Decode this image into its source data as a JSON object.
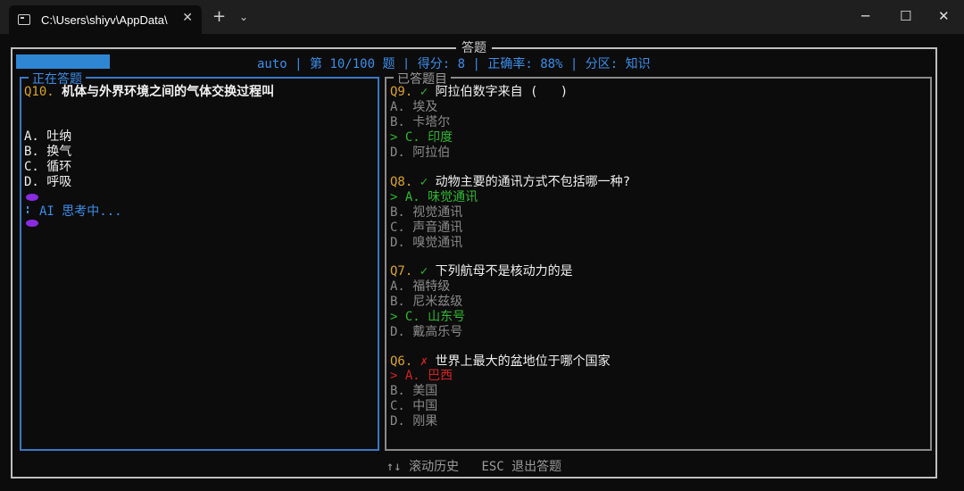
{
  "window": {
    "tab_title": "C:\\Users\\shiyv\\AppData\\",
    "tab_close": "✕",
    "new_tab": "+",
    "dropdown": "⌄",
    "minimize": "─",
    "maximize": "☐",
    "close": "✕"
  },
  "app": {
    "title": "答题",
    "status": {
      "mode": "auto",
      "question": "第 10/100 题",
      "score": "得分: 8",
      "accuracy": "正确率: 88%",
      "category": "分区: 知识"
    }
  },
  "current": {
    "panel_title": "正在答题",
    "q_number": "Q10.",
    "q_text": "机体与外界环境之间的气体交换过程叫",
    "options": [
      "A. 吐纳",
      "B. 换气",
      "C. 循环",
      "D. 呼吸"
    ],
    "thinking": "AI 思考中..."
  },
  "history": {
    "panel_title": "已答题目",
    "items": [
      {
        "number": "Q9.",
        "mark": "✓",
        "text": "阿拉伯数字来自 (   )",
        "options": [
          "A. 埃及",
          "B. 卡塔尔",
          "> C. 印度",
          "D. 阿拉伯"
        ]
      },
      {
        "number": "Q8.",
        "mark": "✓",
        "text": "动物主要的通讯方式不包括哪一种?",
        "options": [
          "> A. 味觉通讯",
          "B. 视觉通讯",
          "C. 声音通讯",
          "D. 嗅觉通讯"
        ]
      },
      {
        "number": "Q7.",
        "mark": "✓",
        "text": "下列航母不是核动力的是",
        "options": [
          "A. 福特级",
          "B. 尼米兹级",
          "> C. 山东号",
          "D. 戴高乐号"
        ]
      },
      {
        "number": "Q6.",
        "mark": "✗",
        "text": "世界上最大的盆地位于哪个国家",
        "options": [
          "> A. 巴西",
          "B. 美国",
          "C. 中国",
          "D. 刚果"
        ]
      }
    ]
  },
  "footer": {
    "scroll": "↑↓ 滚动历史",
    "exit": "ESC 退出答题"
  },
  "colors": {
    "accent_blue": "#3b8eea",
    "correct_green": "#2fb830",
    "wrong_red": "#d62222",
    "question_number": "#d9a327"
  }
}
